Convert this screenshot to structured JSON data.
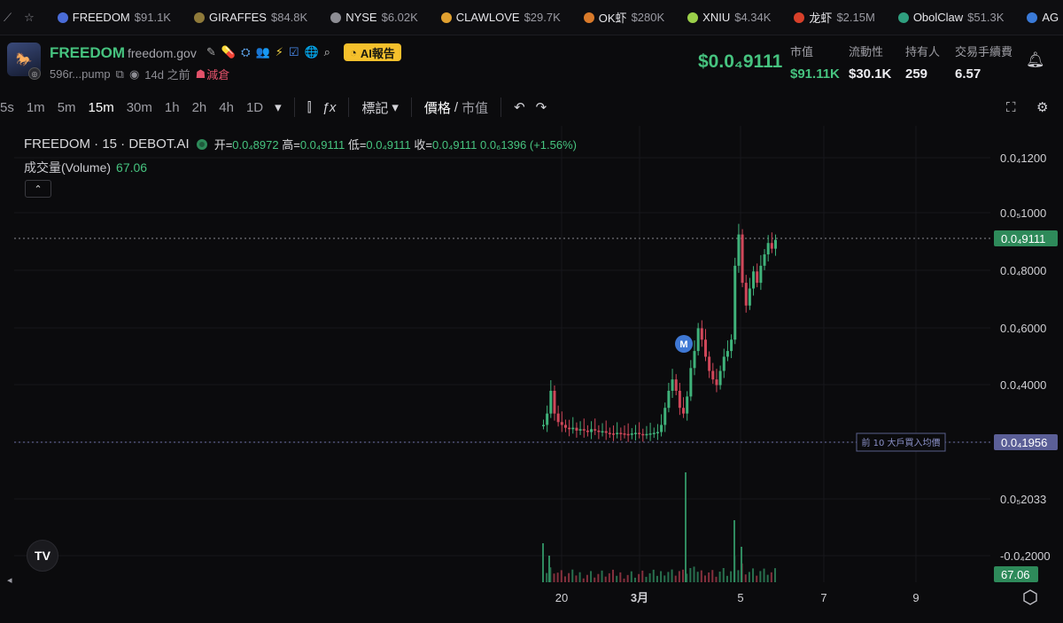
{
  "ticker": {
    "items": [
      {
        "name": "FREEDOM",
        "value": "$91.1K",
        "color": "#4a6cd8"
      },
      {
        "name": "GIRAFFES",
        "value": "$84.8K",
        "color": "#8f7a3a"
      },
      {
        "name": "NYSE",
        "value": "$6.02K",
        "color": "#8d8d94"
      },
      {
        "name": "CLAWLOVE",
        "value": "$29.7K",
        "color": "#e0a030"
      },
      {
        "name": "OK虾",
        "value": "$280K",
        "color": "#d97a2a"
      },
      {
        "name": "XNIU",
        "value": "$4.34K",
        "color": "#9bd04a"
      },
      {
        "name": "龙虾",
        "value": "$2.15M",
        "color": "#d8402a"
      },
      {
        "name": "ObolClaw",
        "value": "$51.3K",
        "color": "#2f9f7f"
      },
      {
        "name": "AG",
        "value": "",
        "color": "#3a7ad8"
      }
    ]
  },
  "token": {
    "name": "FREEDOM",
    "site": "freedom.gov",
    "ai_report": "AI報告",
    "address": "596r...pump",
    "age": "14d 之前",
    "tag": "減倉",
    "price": "$0.0₄9111",
    "stats": [
      {
        "label": "市值",
        "value": "$91.11K",
        "color": "#46c37f"
      },
      {
        "label": "流動性",
        "value": "$30.1K",
        "color": "#ececf0"
      },
      {
        "label": "持有人",
        "value": "259",
        "color": "#ececf0"
      },
      {
        "label": "交易手續費",
        "value": "6.57",
        "color": "#ececf0"
      }
    ]
  },
  "toolbar": {
    "timeframes": [
      "5s",
      "1m",
      "5m",
      "15m",
      "30m",
      "1h",
      "2h",
      "4h",
      "1D"
    ],
    "active": "15m",
    "indicator_icon": "fx-icon",
    "mark_label": "標記",
    "price_label": "價格",
    "mcap_label": "市值"
  },
  "legend": {
    "symbol": "FREEDOM · 15 · DEBOT.AI",
    "open_label": "开=",
    "open": "0.0₄8972",
    "high_label": "高=",
    "high": "0.0₄9111",
    "low_label": "低=",
    "low": "0.0₄9111",
    "close_label": "收=",
    "close": "0.0₄9111",
    "change": "0.0₆1396 (+1.56%)",
    "volume_label": "成交量(Volume)",
    "volume": "67.06"
  },
  "chart_data": {
    "type": "candlestick",
    "y_ticks": [
      "0.0₄1200",
      "0.0₅1000",
      "0.0₄8000",
      "0.0₄6000",
      "0.0₄4000",
      "0.0₄1956",
      "0.0₅2033",
      "-0.0₄2000"
    ],
    "x_ticks": [
      "20",
      "3月",
      "5",
      "7",
      "9"
    ],
    "last_price_label": "0.0₄9111",
    "avg_buy_label": "0.0₄1956",
    "avg_buy_annotation": "前 10 大戶買入均價",
    "volume_label": "67.06",
    "marker": "M",
    "close_series": [
      2.6e-05,
      3e-05,
      3.8e-05,
      3e-05,
      2.7e-05,
      2.6e-05,
      2.5e-05,
      2.45e-05,
      2.5e-05,
      2.4e-05,
      2.45e-05,
      2.4e-05,
      2.35e-05,
      2.45e-05,
      2.4e-05,
      2.35e-05,
      2.38e-05,
      2.32e-05,
      2.3e-05,
      2.28e-05,
      2.32e-05,
      2.3e-05,
      2.28e-05,
      2.25e-05,
      2.3e-05,
      2.32e-05,
      2.28e-05,
      2.26e-05,
      2.28e-05,
      2.3e-05,
      2.32e-05,
      2.35e-05,
      2.6e-05,
      3.2e-05,
      3.8e-05,
      4.2e-05,
      3.8e-05,
      3.2e-05,
      3e-05,
      3.6e-05,
      4.6e-05,
      5.2e-05,
      6e-05,
      5.6e-05,
      5e-05,
      4.5e-05,
      4.2e-05,
      4e-05,
      4.5e-05,
      5e-05,
      5.2e-05,
      5.6e-05,
      8.2e-05,
      9.3e-05,
      7.6e-05,
      6.8e-05,
      7.4e-05,
      8e-05,
      7.6e-05,
      8.2e-05,
      8.6e-05,
      9e-05,
      8.8e-05,
      9.11e-05
    ]
  }
}
